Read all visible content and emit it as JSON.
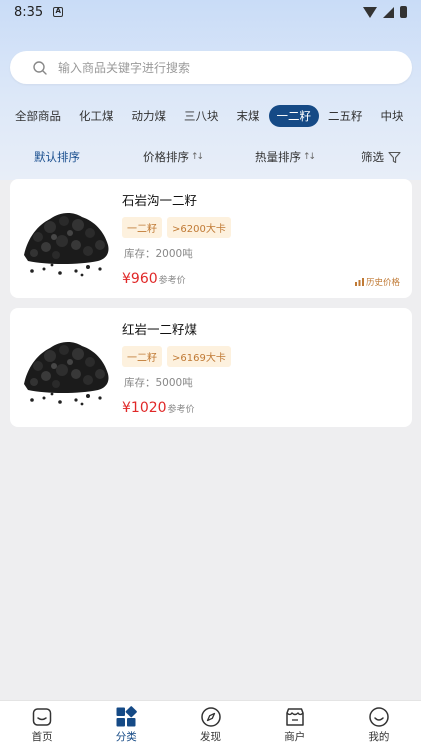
{
  "status_bar": {
    "time": "8:35",
    "sim_label": "A"
  },
  "search": {
    "placeholder": "输入商品关键字进行搜索"
  },
  "categories": [
    "全部商品",
    "化工煤",
    "动力煤",
    "三八块",
    "末煤",
    "一二籽",
    "二五籽",
    "中块"
  ],
  "active_category": "一二籽",
  "sort": {
    "default": "默认排序",
    "price": "价格排序",
    "heat": "热量排序",
    "filter": "筛选",
    "arrows": "↑↓"
  },
  "products": [
    {
      "name": "石岩沟一二籽",
      "tag_size": "一二籽",
      "tag_heat": ">6200大卡",
      "stock": "库存：2000吨",
      "price": "¥960",
      "price_note": "参考价",
      "history": "历史价格"
    },
    {
      "name": "红岩一二籽煤",
      "tag_size": "一二籽",
      "tag_heat": ">6169大卡",
      "stock": "库存：5000吨",
      "price": "¥1020",
      "price_note": "参考价"
    }
  ],
  "nav": [
    {
      "label": "首页",
      "icon": "home-icon"
    },
    {
      "label": "分类",
      "icon": "category-icon"
    },
    {
      "label": "发现",
      "icon": "compass-icon"
    },
    {
      "label": "商户",
      "icon": "store-icon"
    },
    {
      "label": "我的",
      "icon": "smile-icon"
    }
  ],
  "colors": {
    "accent": "#154a86",
    "price": "#e02828",
    "tag_text": "#c07a35",
    "tag_bg": "#fdf1de"
  }
}
